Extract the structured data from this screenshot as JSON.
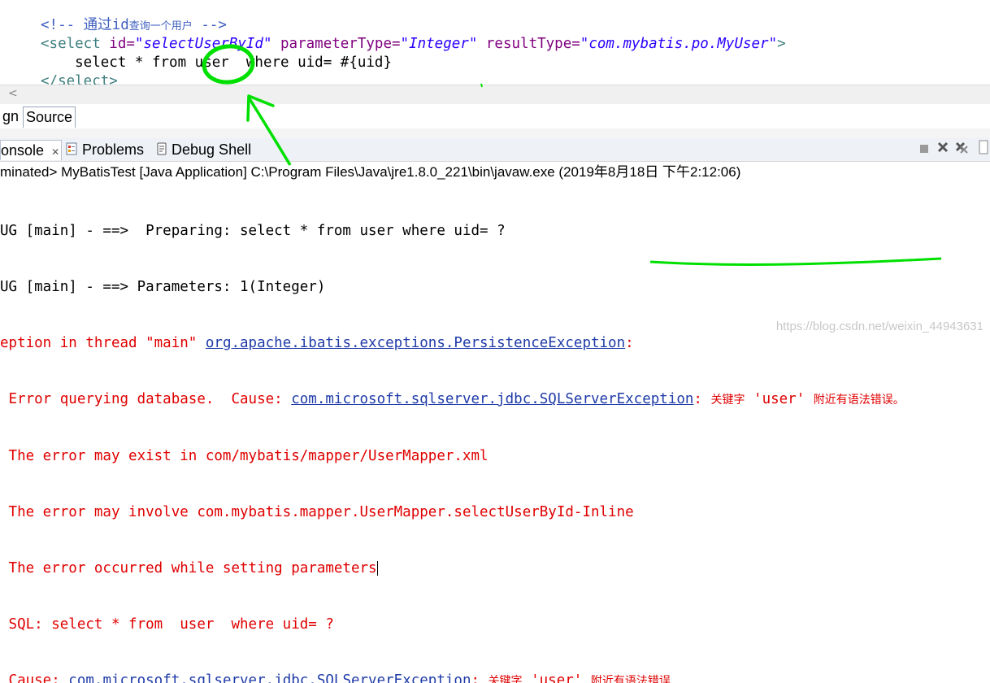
{
  "editor": {
    "lines": {
      "comment_open": "<!-- 通过",
      "comment_id": "id",
      "comment_cn": "查询一个用户",
      "comment_close": " -->",
      "l2_open": "<select ",
      "l2_id_attr": "id=",
      "l2_id_val": "\"selectUserById\"",
      "l2_param_attr": " parameterType=",
      "l2_param_val": "\"Integer\"",
      "l2_result_attr": " resultType=",
      "l2_result_val": "\"com.mybatis.po.MyUser\"",
      "l2_close": ">",
      "l3_sql_a": "    select * from ",
      "l3_user": "user",
      "l3_sql_b": "  where uid= #{uid}",
      "l4": "</select>"
    }
  },
  "scroll": {
    "left_arrow": "<"
  },
  "editor_tabs": {
    "design": "gn",
    "source": "Source"
  },
  "views": {
    "console": "onsole",
    "console_close": "✕",
    "problems": "Problems",
    "debug_shell": "Debug Shell"
  },
  "console": {
    "header": "minated> MyBatisTest [Java Application] C:\\Program Files\\Java\\jre1.8.0_221\\bin\\javaw.exe (2019年8月18日 下午2:12:06)",
    "l1": "UG [main] - ==>  Preparing: select * from user where uid= ?",
    "l2": "UG [main] - ==> Parameters: 1(Integer)",
    "l3_a": "eption in thread \"main\" ",
    "l3_link": "org.apache.ibatis.exceptions.PersistenceException",
    "l3_b": ":",
    "l4_a": " Error querying database.  Cause: ",
    "l4_link": "com.microsoft.sqlserver.jdbc.SQLServerException",
    "l4_b": ": ",
    "l4_cn1": "关键字",
    "l4_user": " 'user' ",
    "l4_cn2": "附近有语法错误。",
    "l5": " The error may exist in com/mybatis/mapper/UserMapper.xml",
    "l6": " The error may involve com.mybatis.mapper.UserMapper.selectUserById-Inline",
    "l7": " The error occurred while setting parameters",
    "l8": " SQL: select * from  user  where uid= ?",
    "l9_a": " Cause: ",
    "l9_link": "com.microsoft.sqlserver.jdbc.SQLServerException",
    "l9_b": ": ",
    "l9_cn1": "关键字",
    "l9_user": " 'user' ",
    "l9_cn2": "附近有语法错误"
  },
  "watermark": "https://blog.csdn.net/weixin_44943631",
  "colors": {
    "annotation_green": "#00e000",
    "error_red": "#e00000",
    "link_blue": "#1f3ba8"
  }
}
